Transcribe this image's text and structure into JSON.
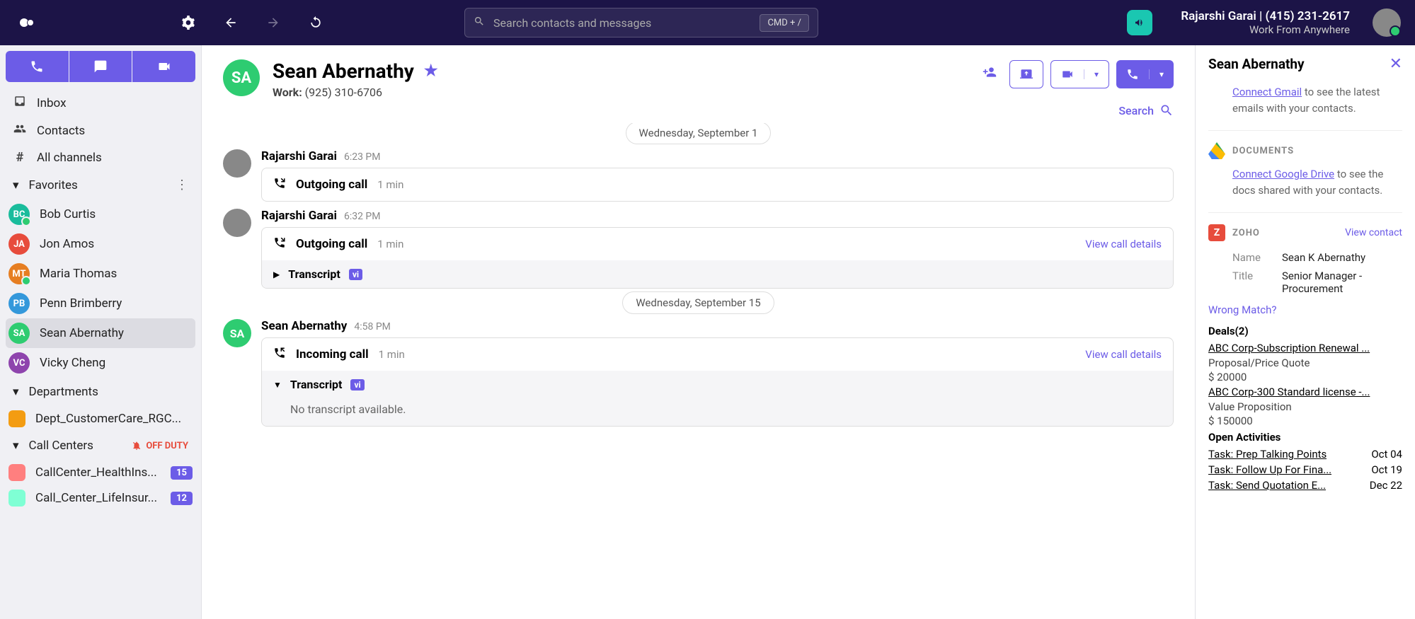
{
  "topbar": {
    "search_placeholder": "Search contacts and messages",
    "kbd_hint": "CMD + /",
    "user_name": "Rajarshi Garai | (415) 231-2617",
    "user_status": "Work From Anywhere"
  },
  "sidebar": {
    "nav": [
      {
        "icon": "inbox",
        "label": "Inbox"
      },
      {
        "icon": "contacts",
        "label": "Contacts"
      },
      {
        "icon": "hash",
        "label": "All channels"
      }
    ],
    "favorites_label": "Favorites",
    "favorites": [
      {
        "initials": "BC",
        "name": "Bob Curtis",
        "color": "#1abc9c",
        "online": true
      },
      {
        "initials": "JA",
        "name": "Jon Amos",
        "color": "#e74c3c",
        "online": false
      },
      {
        "initials": "MT",
        "name": "Maria Thomas",
        "color": "#e67e22",
        "online": true
      },
      {
        "initials": "PB",
        "name": "Penn Brimberry",
        "color": "#3498db",
        "online": false
      },
      {
        "initials": "SA",
        "name": "Sean Abernathy",
        "color": "#2ecc71",
        "online": false,
        "active": true
      },
      {
        "initials": "VC",
        "name": "Vicky Cheng",
        "color": "#8e44ad",
        "online": false
      }
    ],
    "departments_label": "Departments",
    "departments": [
      {
        "color": "#f39c12",
        "name": "Dept_CustomerCare_RGC..."
      }
    ],
    "callcenters_label": "Call Centers",
    "off_duty_label": "OFF DUTY",
    "callcenters": [
      {
        "color": "#ff7f7f",
        "name": "CallCenter_HealthIns...",
        "badge": "15"
      },
      {
        "color": "#7fffd4",
        "name": "Call_Center_LifeInsur...",
        "badge": "12"
      }
    ]
  },
  "contact": {
    "initials": "SA",
    "name": "Sean Abernathy",
    "phone_label": "Work:",
    "phone": "(925) 310-6706",
    "search_label": "Search"
  },
  "timeline": [
    {
      "type": "date",
      "text": "Wednesday, September 1"
    },
    {
      "type": "call",
      "author": "Rajarshi Garai",
      "time": "6:23 PM",
      "call_type": "Outgoing call",
      "duration": "1 min",
      "avatar": "photo"
    },
    {
      "type": "call",
      "author": "Rajarshi Garai",
      "time": "6:32 PM",
      "call_type": "Outgoing call",
      "duration": "1 min",
      "details_link": "View call details",
      "transcript": {
        "expanded": false,
        "label": "Transcript"
      },
      "avatar": "photo"
    },
    {
      "type": "date",
      "text": "Wednesday, September 15"
    },
    {
      "type": "call",
      "author": "Sean Abernathy",
      "time": "4:58 PM",
      "call_type": "Incoming call",
      "duration": "1 min",
      "details_link": "View call details",
      "transcript": {
        "expanded": true,
        "label": "Transcript",
        "content": "No transcript available."
      },
      "avatar": "SA"
    }
  ],
  "rightpanel": {
    "title": "Sean Abernathy",
    "gmail_link": "Connect Gmail",
    "gmail_text": " to see the latest emails with your contacts.",
    "docs_label": "DOCUMENTS",
    "gdrive_link": "Connect Google Drive",
    "gdrive_text": " to see the docs shared with your contacts.",
    "zoho_label": "ZOHO",
    "zoho_view": "View contact",
    "fields": [
      {
        "label": "Name",
        "value": "Sean K Abernathy"
      },
      {
        "label": "Title",
        "value": "Senior Manager - Procurement"
      }
    ],
    "wrong_match": "Wrong Match?",
    "deals_title": "Deals(2)",
    "deals": [
      {
        "name": "ABC Corp-Subscription Renewal ...",
        "stage": "Proposal/Price Quote",
        "amount": "$ 20000"
      },
      {
        "name": "ABC Corp-300 Standard license -...",
        "stage": "Value Proposition",
        "amount": "$ 150000"
      }
    ],
    "activities_title": "Open Activities",
    "activities": [
      {
        "name": "Task: Prep Talking Points",
        "date": "Oct 04"
      },
      {
        "name": "Task: Follow Up For Fina...",
        "date": "Oct 19"
      },
      {
        "name": "Task: Send Quotation E...",
        "date": "Dec 22"
      }
    ]
  }
}
